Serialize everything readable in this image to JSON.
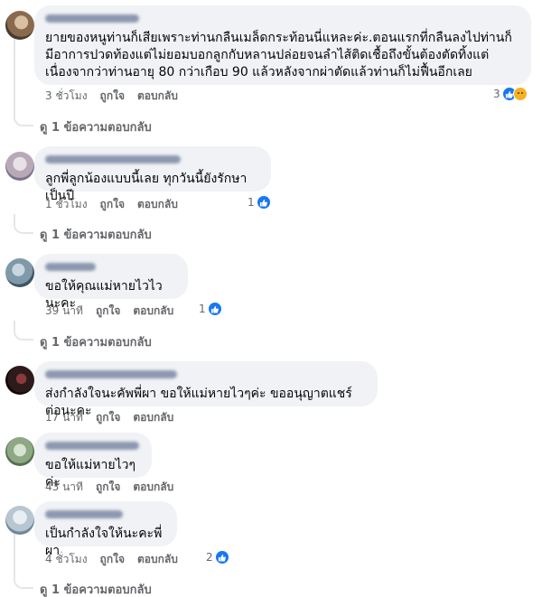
{
  "comments": [
    {
      "text": "ยายของหนูท่านก็เสียเพราะท่านกลืนเมล็ดกระท้อนนี่แหละค่ะ.ตอนแรกที่กลืนลงไปท่านก็มีอาการปวดท้องแต่ไม่ยอมบอกลูกกับหลานปล่อยจนลำไส้ติดเชื้อถึงขั้นต้องตัดทิ้งแต่เนื่องจากว่าท่านอายุ 80 กว่าเกือบ 90 แล้วหลังจากผ่าตัดแล้วท่านก็ไม่ฟื้นอีกเลย",
      "time": "3 ชั่วโมง",
      "like": "ถูกใจ",
      "reply": "ตอบกลับ",
      "reaction_count": "3",
      "reactions": [
        "like",
        "sad"
      ],
      "view_replies": "ดู 1 ข้อความตอบกลับ"
    },
    {
      "text": "ลูกพี่ลูกน้องแบบนี้เลย ทุกวันนี้ยังรักษาเป็นปี",
      "time": "1 ชั่วโมง",
      "like": "ถูกใจ",
      "reply": "ตอบกลับ",
      "reaction_count": "1",
      "reactions": [
        "like"
      ],
      "view_replies": "ดู 1 ข้อความตอบกลับ"
    },
    {
      "text": "ขอให้คุณแม่หายไวไวนะคะ",
      "time": "39 นาที",
      "like": "ถูกใจ",
      "reply": "ตอบกลับ",
      "reaction_count": "1",
      "reactions": [
        "like"
      ],
      "view_replies": "ดู 1 ข้อความตอบกลับ"
    },
    {
      "text": "ส่งกำลังใจนะคัพพี่ผา ขอให้แม่หายไวๆค่ะ ขออนุญาตแชร์ต่อนะคะ",
      "time": "17 นาที",
      "like": "ถูกใจ",
      "reply": "ตอบกลับ"
    },
    {
      "text": "ขอให้แม่หายไวๆค่ะ",
      "time": "43 นาที",
      "like": "ถูกใจ",
      "reply": "ตอบกลับ"
    },
    {
      "text": "เป็นกำลังใจให้นะคะพี่ผา",
      "time": "4 ชั่วโมง",
      "like": "ถูกใจ",
      "reply": "ตอบกลับ",
      "reaction_count": "2",
      "reactions": [
        "like"
      ],
      "view_replies": "ดู 1 ข้อความตอบกลับ"
    }
  ],
  "colors": {
    "bubble": "#f0f2f5",
    "like_blue": "#1877f2",
    "meta_gray": "#65676b"
  }
}
